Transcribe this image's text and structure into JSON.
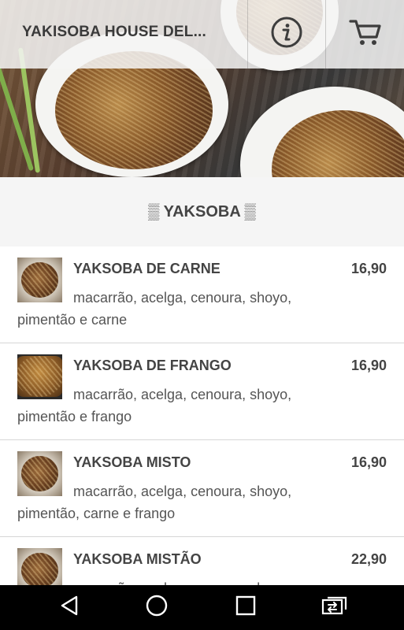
{
  "header": {
    "title": "YAKISOBA HOUSE DEL...",
    "info_icon": "info-circle-icon",
    "cart_icon": "cart-icon"
  },
  "section": {
    "title": "▒ YAKSOBA ▒"
  },
  "menu_items": [
    {
      "name": "YAKSOBA DE CARNE",
      "price": "16,90",
      "description": "macarrão, acelga, cenoura, shoyo, pimentão e carne"
    },
    {
      "name": "YAKSOBA DE FRANGO",
      "price": "16,90",
      "description": "macarrão, acelga, cenoura, shoyo, pimentão e frango"
    },
    {
      "name": "YAKSOBA MISTO",
      "price": "16,90",
      "description": "macarrão, acelga, cenoura, shoyo, pimentão, carne e frango"
    },
    {
      "name": "YAKSOBA MISTÃO",
      "price": "22,90",
      "description": "macarrão, acelga, cenoura, shoyo,"
    }
  ],
  "navbar": {
    "back_icon": "back-triangle-icon",
    "home_icon": "home-circle-icon",
    "recents_icon": "recents-square-icon",
    "switch_icon": "switch-app-icon"
  },
  "colors": {
    "header_bg": "#f5f5f5",
    "text": "#444444",
    "navbar_bg": "#000000"
  }
}
